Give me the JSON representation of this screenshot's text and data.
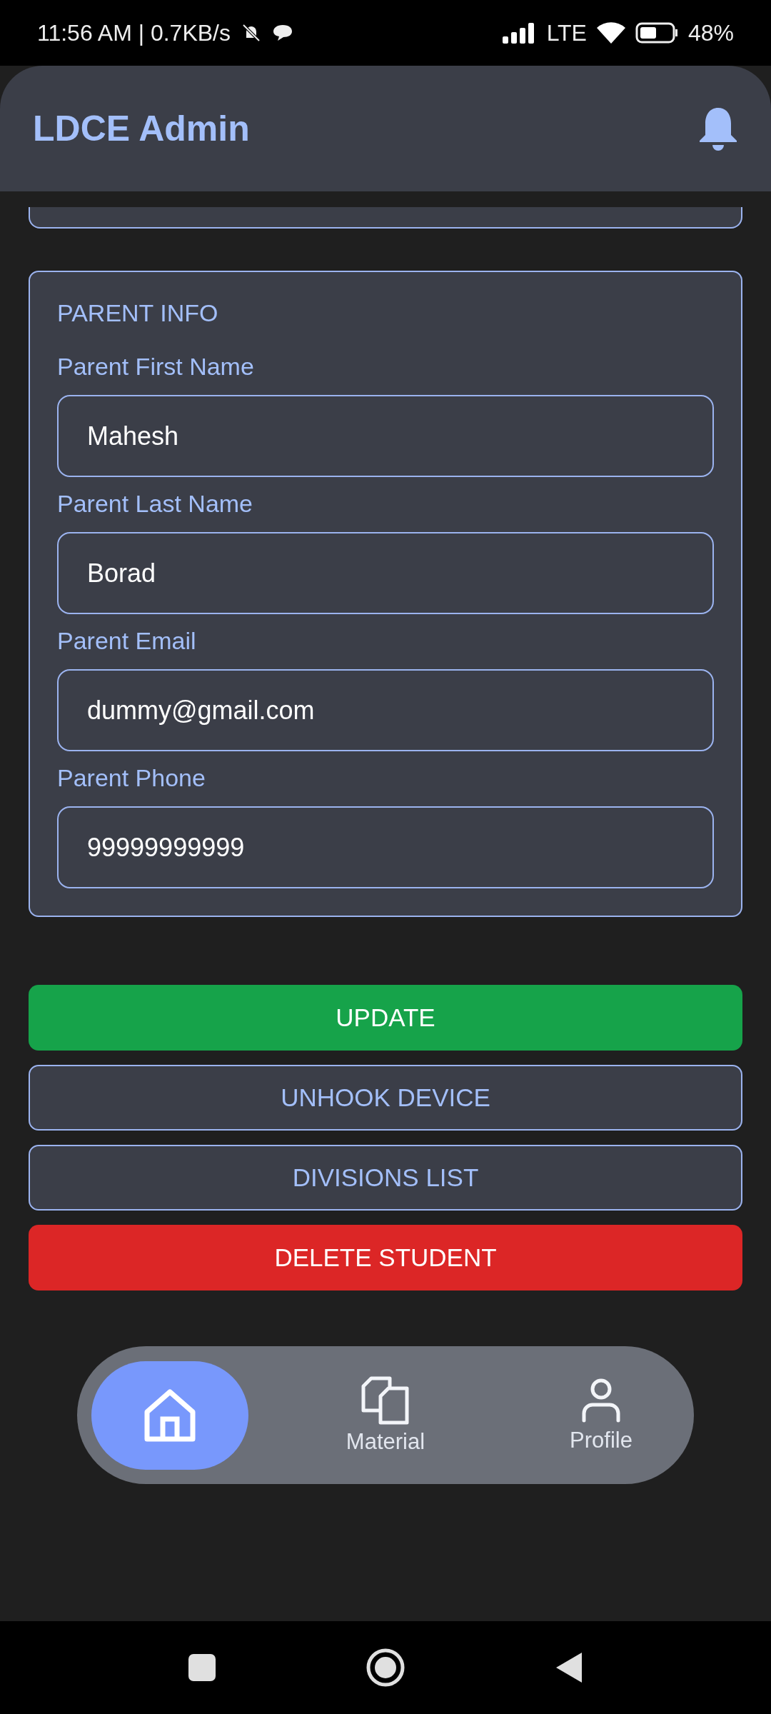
{
  "status_bar": {
    "time": "11:56 AM | 0.7KB/s",
    "network": "LTE",
    "battery": "48%"
  },
  "app_bar": {
    "title": "LDCE Admin"
  },
  "parent_info": {
    "heading": "PARENT INFO",
    "fields": [
      {
        "label": "Parent First Name",
        "value": "Mahesh"
      },
      {
        "label": "Parent Last Name",
        "value": "Borad"
      },
      {
        "label": "Parent Email",
        "value": "dummy@gmail.com"
      },
      {
        "label": "Parent Phone",
        "value": "99999999999"
      }
    ]
  },
  "buttons": [
    {
      "label": "UPDATE",
      "kind": "success"
    },
    {
      "label": "UNHOOK DEVICE",
      "kind": "outline"
    },
    {
      "label": "DIVISIONS LIST",
      "kind": "outline"
    },
    {
      "label": "DELETE STUDENT",
      "kind": "danger"
    }
  ],
  "bottom_nav": [
    {
      "kind": "home",
      "selected": true
    },
    {
      "kind": "material",
      "label": "Material",
      "selected": false
    },
    {
      "kind": "profile",
      "label": "Profile",
      "selected": false
    }
  ]
}
